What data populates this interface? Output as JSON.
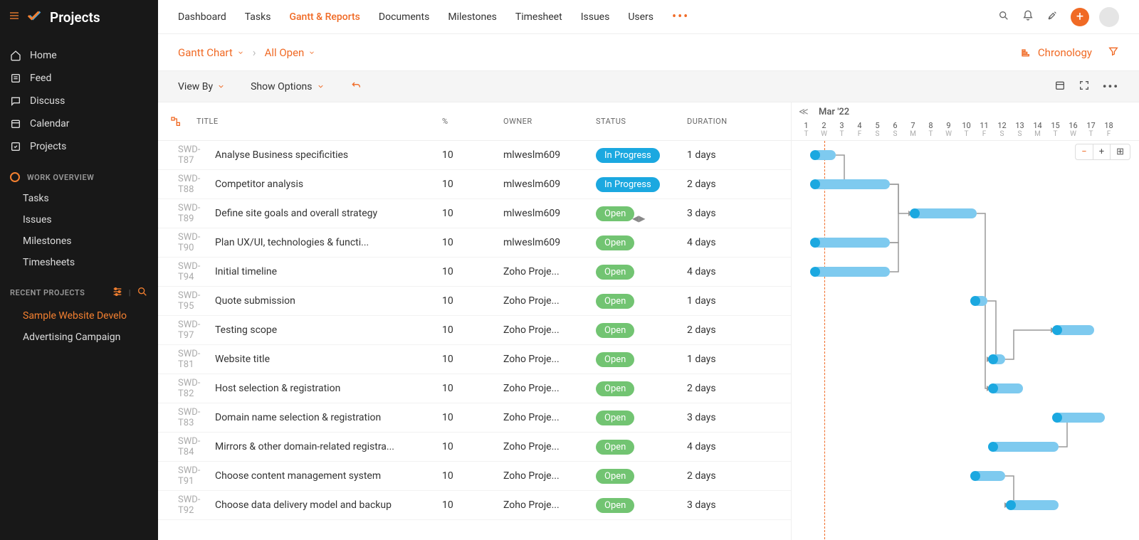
{
  "app_name": "Projects",
  "sidebar": {
    "nav": [
      {
        "label": "Home"
      },
      {
        "label": "Feed"
      },
      {
        "label": "Discuss"
      },
      {
        "label": "Calendar"
      },
      {
        "label": "Projects"
      }
    ],
    "overview_header": "WORK OVERVIEW",
    "overview": [
      {
        "label": "Tasks"
      },
      {
        "label": "Issues"
      },
      {
        "label": "Milestones"
      },
      {
        "label": "Timesheets"
      }
    ],
    "recent_header": "RECENT PROJECTS",
    "recent": [
      {
        "label": "Sample Website Develo",
        "active": true
      },
      {
        "label": "Advertising Campaign",
        "active": false
      }
    ]
  },
  "topnav": {
    "tabs": [
      {
        "label": "Dashboard"
      },
      {
        "label": "Tasks"
      },
      {
        "label": "Gantt & Reports",
        "active": true
      },
      {
        "label": "Documents"
      },
      {
        "label": "Milestones"
      },
      {
        "label": "Timesheet"
      },
      {
        "label": "Issues"
      },
      {
        "label": "Users"
      }
    ]
  },
  "subnav": {
    "crumb1": "Gantt Chart",
    "crumb2": "All Open",
    "chronology": "Chronology"
  },
  "toolbar": {
    "view_by": "View By",
    "show_options": "Show Options"
  },
  "grid": {
    "headers": {
      "title": "TITLE",
      "pct": "%",
      "owner": "OWNER",
      "status": "STATUS",
      "duration": "DURATION"
    }
  },
  "rows": [
    {
      "id": "SWD-T87",
      "title": "Analyse Business specificities",
      "pct": "10",
      "owner": "mlweslm609",
      "status": "In Progress",
      "duration": "1 days",
      "bar_start": 30,
      "bar_len": 32
    },
    {
      "id": "SWD-T88",
      "title": "Competitor analysis",
      "pct": "10",
      "owner": "mlweslm609",
      "status": "In Progress",
      "duration": "2 days",
      "bar_start": 30,
      "bar_len": 108
    },
    {
      "id": "SWD-T89",
      "title": "Define site goals and overall strategy",
      "pct": "10",
      "owner": "mlweslm609",
      "status": "Open",
      "duration": "3 days",
      "bar_start": 170,
      "bar_len": 90
    },
    {
      "id": "SWD-T90",
      "title": "Plan UX&#x2f;UI, technologies & functi...",
      "pct": "10",
      "owner": "mlweslm609",
      "status": "Open",
      "duration": "4 days",
      "bar_start": 30,
      "bar_len": 108
    },
    {
      "id": "SWD-T94",
      "title": "Initial timeline",
      "pct": "10",
      "owner": "Zoho Proje...",
      "status": "Open",
      "duration": "4 days",
      "bar_start": 30,
      "bar_len": 108
    },
    {
      "id": "SWD-T95",
      "title": "Quote submission",
      "pct": "10",
      "owner": "Zoho Proje...",
      "status": "Open",
      "duration": "1 days",
      "bar_start": 255,
      "bar_len": 20
    },
    {
      "id": "SWD-T97",
      "title": "Testing scope",
      "pct": "10",
      "owner": "Zoho Proje...",
      "status": "Open",
      "duration": "2 days",
      "bar_start": 370,
      "bar_len": 55
    },
    {
      "id": "SWD-T81",
      "title": "Website title",
      "pct": "10",
      "owner": "Zoho Proje...",
      "status": "Open",
      "duration": "1 days",
      "bar_start": 280,
      "bar_len": 20
    },
    {
      "id": "SWD-T82",
      "title": "Host selection & registration",
      "pct": "10",
      "owner": "Zoho Proje...",
      "status": "Open",
      "duration": "2 days",
      "bar_start": 280,
      "bar_len": 45
    },
    {
      "id": "SWD-T83",
      "title": "Domain name selection & registration",
      "pct": "10",
      "owner": "Zoho Proje...",
      "status": "Open",
      "duration": "3 days",
      "bar_start": 370,
      "bar_len": 70
    },
    {
      "id": "SWD-T84",
      "title": "Mirrors & other domain-related registra...",
      "pct": "10",
      "owner": "Zoho Proje...",
      "status": "Open",
      "duration": "4 days",
      "bar_start": 280,
      "bar_len": 95
    },
    {
      "id": "SWD-T91",
      "title": "Choose content management system",
      "pct": "10",
      "owner": "Zoho Proje...",
      "status": "Open",
      "duration": "2 days",
      "bar_start": 255,
      "bar_len": 45
    },
    {
      "id": "SWD-T92",
      "title": "Choose data delivery model and backup",
      "pct": "10",
      "owner": "Zoho Proje...",
      "status": "Open",
      "duration": "3 days",
      "bar_start": 305,
      "bar_len": 70
    }
  ],
  "gantt": {
    "month": "Mar '22",
    "days": [
      {
        "n": "1",
        "d": "T"
      },
      {
        "n": "2",
        "d": "W"
      },
      {
        "n": "3",
        "d": "T"
      },
      {
        "n": "4",
        "d": "F"
      },
      {
        "n": "5",
        "d": "S"
      },
      {
        "n": "6",
        "d": "S"
      },
      {
        "n": "7",
        "d": "M"
      },
      {
        "n": "8",
        "d": "T"
      },
      {
        "n": "9",
        "d": "W"
      },
      {
        "n": "10",
        "d": "T"
      },
      {
        "n": "11",
        "d": "F"
      },
      {
        "n": "12",
        "d": "S"
      },
      {
        "n": "13",
        "d": "S"
      },
      {
        "n": "14",
        "d": "M"
      },
      {
        "n": "15",
        "d": "T"
      },
      {
        "n": "16",
        "d": "W"
      },
      {
        "n": "17",
        "d": "T"
      },
      {
        "n": "18",
        "d": "F"
      }
    ]
  },
  "colors": {
    "accent": "#f06a25",
    "progress": "#1ba8e0",
    "open": "#72c472",
    "bar": "#7ecaef"
  }
}
